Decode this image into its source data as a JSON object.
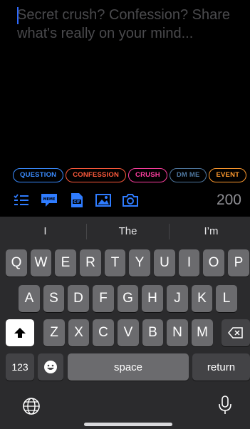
{
  "composer": {
    "placeholder": "Secret crush? Confession? Share what's really on your mind..."
  },
  "tags": [
    {
      "label": "QUESTION",
      "color": "#3a8bff"
    },
    {
      "label": "CONFESSION",
      "color": "#ff5a3c"
    },
    {
      "label": "CRUSH",
      "color": "#ff3fa0"
    },
    {
      "label": "DM ME",
      "color": "#4f78a0"
    },
    {
      "label": "EVENT",
      "color": "#ff9a2e"
    }
  ],
  "toolbar": {
    "icons": [
      "list-icon",
      "meme-icon",
      "gif-icon",
      "image-icon",
      "camera-icon"
    ],
    "accent_color": "#2f7cff",
    "char_counter": "200"
  },
  "keyboard": {
    "suggestions": [
      "I",
      "The",
      "I’m"
    ],
    "row1": [
      "Q",
      "W",
      "E",
      "R",
      "T",
      "Y",
      "U",
      "I",
      "O",
      "P"
    ],
    "row2": [
      "A",
      "S",
      "D",
      "F",
      "G",
      "H",
      "J",
      "K",
      "L"
    ],
    "row3": [
      "Z",
      "X",
      "C",
      "V",
      "B",
      "N",
      "M"
    ],
    "numbers_label": "123",
    "space_label": "space",
    "return_label": "return"
  }
}
